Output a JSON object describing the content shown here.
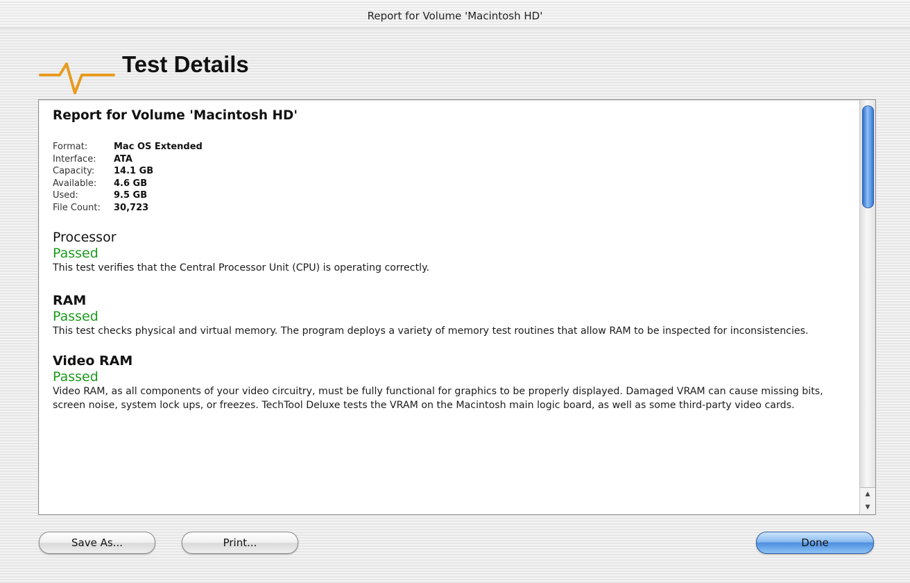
{
  "window": {
    "title": "Report for Volume 'Macintosh HD'"
  },
  "header": {
    "title": "Test Details",
    "logo_icon": "pulse-wave-icon",
    "accent_color": "#e89b1e"
  },
  "report": {
    "heading": "Report for Volume 'Macintosh HD'",
    "info": [
      {
        "label": "Format:",
        "value": "Mac OS Extended"
      },
      {
        "label": "Interface:",
        "value": "ATA"
      },
      {
        "label": "Capacity:",
        "value": "14.1 GB"
      },
      {
        "label": "Available:",
        "value": "4.6 GB"
      },
      {
        "label": "Used:",
        "value": "9.5 GB"
      },
      {
        "label": "File Count:",
        "value": "30,723"
      }
    ],
    "sections": [
      {
        "title": "Processor",
        "status": "Passed",
        "description": "This test verifies that the Central Processor Unit (CPU) is operating correctly."
      },
      {
        "title": "RAM",
        "status": "Passed",
        "description": "This test checks physical and virtual memory. The program deploys a variety of memory test routines that allow RAM to be inspected for inconsistencies."
      },
      {
        "title": "Video RAM",
        "status": "Passed",
        "description": "Video RAM, as all components of your video circuitry, must be fully functional for graphics to be properly displayed. Damaged VRAM can cause missing bits, screen noise, system lock ups, or freezes. TechTool Deluxe tests the VRAM on the Macintosh main logic board, as well as some third-party video cards."
      }
    ],
    "status_color": "#1a9a1a"
  },
  "buttons": {
    "save": "Save As...",
    "print": "Print...",
    "done": "Done"
  }
}
